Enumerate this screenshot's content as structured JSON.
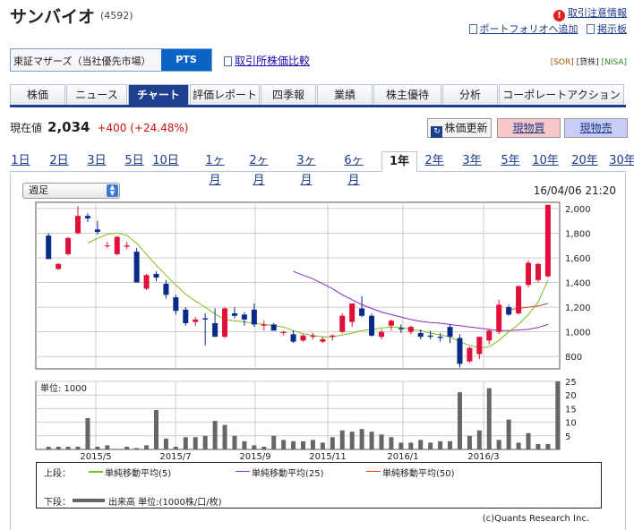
{
  "stock": {
    "name": "サンバイオ",
    "code": "(4592)"
  },
  "links": {
    "warning": "取引注意情報",
    "portfolio": "ポートフォリオへ追加",
    "board": "掲示板"
  },
  "market": {
    "label": "東証マザーズ（当社優先市場）",
    "pts": "PTS",
    "compare": "取引所株価比較",
    "badges": [
      "[SOR]",
      "[貸株]",
      "[NISA]"
    ]
  },
  "tabs": [
    "株価",
    "ニュース",
    "チャート",
    "評価レポート",
    "四季報",
    "業績",
    "株主優待",
    "分析",
    "コーポレートアクション"
  ],
  "active_tab": 2,
  "price": {
    "label": "現在値",
    "value": "2,034",
    "change": "+400 (+24.48%)"
  },
  "buttons": {
    "update": "株価更新",
    "buy": "現物買",
    "sell": "現物売"
  },
  "periods": [
    "1日",
    "2日",
    "3日",
    "5日",
    "10日",
    "1ヶ月",
    "2ヶ月",
    "3ヶ月",
    "6ヶ月",
    "1年",
    "2年",
    "3年",
    "5年",
    "10年",
    "20年",
    "30年"
  ],
  "active_period": 9,
  "select": {
    "value": "週足"
  },
  "timestamp": "16/04/06 21:20",
  "legend": {
    "upper": "上段：",
    "lower": "下段：",
    "ma5": "単純移動平均(5)",
    "ma25": "単純移動平均(25)",
    "ma50": "単純移動平均(50)",
    "volume": "出来高 単位:(1000株/口/枚)",
    "colors": {
      "ma5": "#7abf1a",
      "ma25": "#8a2bc8",
      "ma50": "#e03a10",
      "volume": "#666666",
      "up": "#e0103a",
      "down": "#0a2a8a"
    }
  },
  "copyright": "(c)Quants Research Inc.",
  "chart_data": [
    {
      "type": "candlestick",
      "ylim": [
        700,
        2050
      ],
      "yticks": [
        800,
        1000,
        1200,
        1400,
        1600,
        1800,
        2000
      ],
      "xticks": [
        "2015/5",
        "2015/7",
        "2015/9",
        "2015/11",
        "2016/1",
        "2016/3"
      ],
      "candles": [
        {
          "o": 1780,
          "h": 1800,
          "l": 1600,
          "c": 1590
        },
        {
          "o": 1510,
          "h": 1560,
          "l": 1500,
          "c": 1550
        },
        {
          "o": 1630,
          "h": 1770,
          "l": 1620,
          "c": 1760
        },
        {
          "o": 1800,
          "h": 2020,
          "l": 1790,
          "c": 1940
        },
        {
          "o": 1940,
          "h": 1960,
          "l": 1890,
          "c": 1920
        },
        {
          "o": 1830,
          "h": 1900,
          "l": 1790,
          "c": 1810
        },
        {
          "o": 1700,
          "h": 1730,
          "l": 1680,
          "c": 1700
        },
        {
          "o": 1630,
          "h": 1780,
          "l": 1620,
          "c": 1770
        },
        {
          "o": 1690,
          "h": 1730,
          "l": 1670,
          "c": 1700
        },
        {
          "o": 1650,
          "h": 1680,
          "l": 1400,
          "c": 1400
        },
        {
          "o": 1350,
          "h": 1470,
          "l": 1340,
          "c": 1460
        },
        {
          "o": 1470,
          "h": 1490,
          "l": 1410,
          "c": 1440
        },
        {
          "o": 1390,
          "h": 1420,
          "l": 1270,
          "c": 1300
        },
        {
          "o": 1280,
          "h": 1300,
          "l": 1140,
          "c": 1170
        },
        {
          "o": 1180,
          "h": 1200,
          "l": 1050,
          "c": 1070
        },
        {
          "o": 1080,
          "h": 1120,
          "l": 1050,
          "c": 1100
        },
        {
          "o": 1110,
          "h": 1150,
          "l": 890,
          "c": 1100
        },
        {
          "o": 1070,
          "h": 1190,
          "l": 960,
          "c": 960
        },
        {
          "o": 960,
          "h": 1200,
          "l": 950,
          "c": 1190
        },
        {
          "o": 1150,
          "h": 1200,
          "l": 1110,
          "c": 1130
        },
        {
          "o": 1140,
          "h": 1160,
          "l": 1050,
          "c": 1100
        },
        {
          "o": 1180,
          "h": 1230,
          "l": 1040,
          "c": 1060
        },
        {
          "o": 1050,
          "h": 1090,
          "l": 1010,
          "c": 1060
        },
        {
          "o": 1060,
          "h": 1070,
          "l": 1010,
          "c": 1010
        },
        {
          "o": 990,
          "h": 1010,
          "l": 970,
          "c": 1000
        },
        {
          "o": 980,
          "h": 1010,
          "l": 910,
          "c": 920
        },
        {
          "o": 930,
          "h": 980,
          "l": 920,
          "c": 970
        },
        {
          "o": 960,
          "h": 990,
          "l": 940,
          "c": 970
        },
        {
          "o": 920,
          "h": 960,
          "l": 910,
          "c": 940
        },
        {
          "o": 960,
          "h": 980,
          "l": 930,
          "c": 970
        },
        {
          "o": 1000,
          "h": 1150,
          "l": 990,
          "c": 1130
        },
        {
          "o": 1080,
          "h": 1230,
          "l": 1040,
          "c": 1230
        },
        {
          "o": 1190,
          "h": 1290,
          "l": 1120,
          "c": 1130
        },
        {
          "o": 1130,
          "h": 1150,
          "l": 960,
          "c": 970
        },
        {
          "o": 960,
          "h": 1020,
          "l": 940,
          "c": 1000
        },
        {
          "o": 1050,
          "h": 1100,
          "l": 1010,
          "c": 1090
        },
        {
          "o": 1030,
          "h": 1060,
          "l": 990,
          "c": 1020
        },
        {
          "o": 1000,
          "h": 1050,
          "l": 980,
          "c": 1040
        },
        {
          "o": 990,
          "h": 1020,
          "l": 940,
          "c": 960
        },
        {
          "o": 970,
          "h": 1010,
          "l": 940,
          "c": 960
        },
        {
          "o": 960,
          "h": 990,
          "l": 920,
          "c": 950
        },
        {
          "o": 1040,
          "h": 1060,
          "l": 910,
          "c": 960
        },
        {
          "o": 950,
          "h": 980,
          "l": 710,
          "c": 740
        },
        {
          "o": 760,
          "h": 880,
          "l": 750,
          "c": 870
        },
        {
          "o": 820,
          "h": 960,
          "l": 780,
          "c": 960
        },
        {
          "o": 930,
          "h": 1020,
          "l": 900,
          "c": 1010
        },
        {
          "o": 1000,
          "h": 1260,
          "l": 980,
          "c": 1220
        },
        {
          "o": 1200,
          "h": 1220,
          "l": 1130,
          "c": 1140
        },
        {
          "o": 1150,
          "h": 1380,
          "l": 1140,
          "c": 1370
        },
        {
          "o": 1380,
          "h": 1580,
          "l": 1360,
          "c": 1560
        },
        {
          "o": 1420,
          "h": 1560,
          "l": 1400,
          "c": 1550
        },
        {
          "o": 1450,
          "h": 2030,
          "l": 1440,
          "c": 2030
        }
      ],
      "ma5": [
        null,
        null,
        null,
        null,
        1720,
        1758,
        1790,
        1800,
        1782,
        1718,
        1628,
        1540,
        1460,
        1380,
        1305,
        1250,
        1200,
        1145,
        1100,
        1090,
        1080,
        1070,
        1060,
        1050,
        1040,
        1010,
        985,
        970,
        960,
        960,
        975,
        990,
        1010,
        1020,
        1030,
        1040,
        1035,
        1020,
        1010,
        990,
        975,
        960,
        920,
        890,
        870,
        880,
        930,
        1000,
        1060,
        1140,
        1240,
        1420
      ],
      "ma25": [
        null,
        null,
        null,
        null,
        null,
        null,
        null,
        null,
        null,
        null,
        null,
        null,
        null,
        null,
        null,
        null,
        null,
        null,
        null,
        null,
        null,
        null,
        null,
        null,
        null,
        1490,
        1460,
        1430,
        1390,
        1350,
        1300,
        1260,
        1220,
        1190,
        1160,
        1140,
        1120,
        1100,
        1085,
        1075,
        1070,
        1060,
        1050,
        1040,
        1030,
        1020,
        1010,
        1010,
        1015,
        1020,
        1035,
        1060
      ],
      "ma50": [
        null,
        null,
        null,
        null,
        null,
        null,
        null,
        null,
        null,
        null,
        null,
        null,
        null,
        null,
        null,
        null,
        null,
        null,
        null,
        null,
        null,
        null,
        null,
        null,
        null,
        null,
        null,
        null,
        null,
        null,
        null,
        null,
        null,
        null,
        null,
        null,
        null,
        null,
        null,
        null,
        null,
        null,
        null,
        null,
        null,
        null,
        null,
        1180,
        1190,
        1200,
        1210,
        1230
      ]
    },
    {
      "type": "bar",
      "name": "出来高",
      "unit_label": "単位: 1000",
      "ylim": [
        0,
        25
      ],
      "yticks": [
        5,
        10,
        15,
        20,
        25
      ],
      "values": [
        1,
        1,
        1,
        1,
        11.5,
        1,
        1.5,
        0,
        1,
        0.5,
        1.5,
        14.5,
        4,
        1,
        4.5,
        4.5,
        5,
        10.5,
        9,
        5,
        3,
        1.5,
        1,
        5,
        3.5,
        3,
        3,
        3.5,
        2.5,
        4.5,
        7,
        6.5,
        7.5,
        6.5,
        5.5,
        4.5,
        2.5,
        2.5,
        3.5,
        2.5,
        3,
        3,
        21,
        5,
        7,
        22.5,
        3.5,
        11,
        2.5,
        6,
        2,
        2,
        25
      ]
    }
  ]
}
